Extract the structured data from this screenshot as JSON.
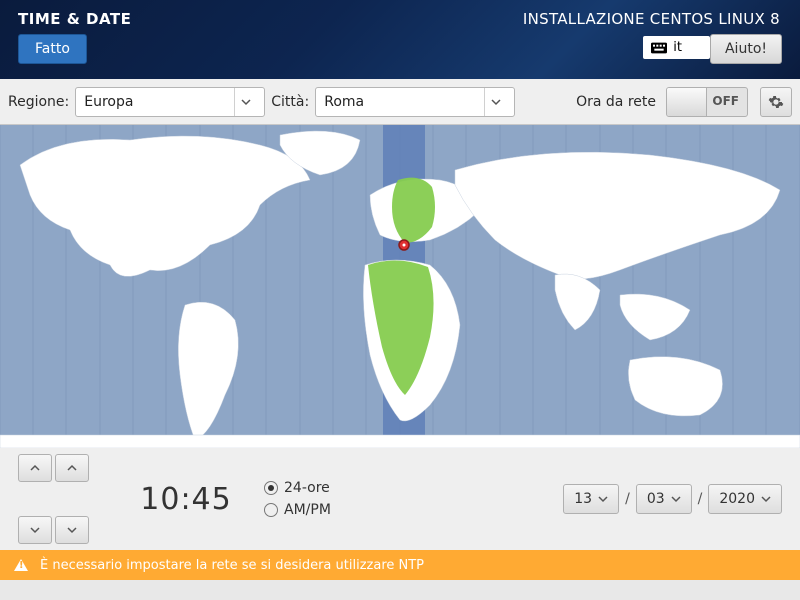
{
  "header": {
    "title": "TIME & DATE",
    "done": "Fatto",
    "product": "INSTALLAZIONE CENTOS LINUX 8",
    "keyboard": "it",
    "help": "Aiuto!"
  },
  "toolbar": {
    "region_label": "Regione:",
    "region_value": "Europa",
    "city_label": "Città:",
    "city_value": "Roma",
    "network_time_label": "Ora da rete",
    "network_time_state": "OFF"
  },
  "time": {
    "hours": "10",
    "minutes": "45",
    "format_24_label": "24-ore",
    "format_ampm_label": "AM/PM",
    "selected_format": "24"
  },
  "date": {
    "day": "13",
    "month": "03",
    "year": "2020"
  },
  "warning": {
    "text": "È necessario impostare la rete se si desidera utilizzare NTP"
  }
}
